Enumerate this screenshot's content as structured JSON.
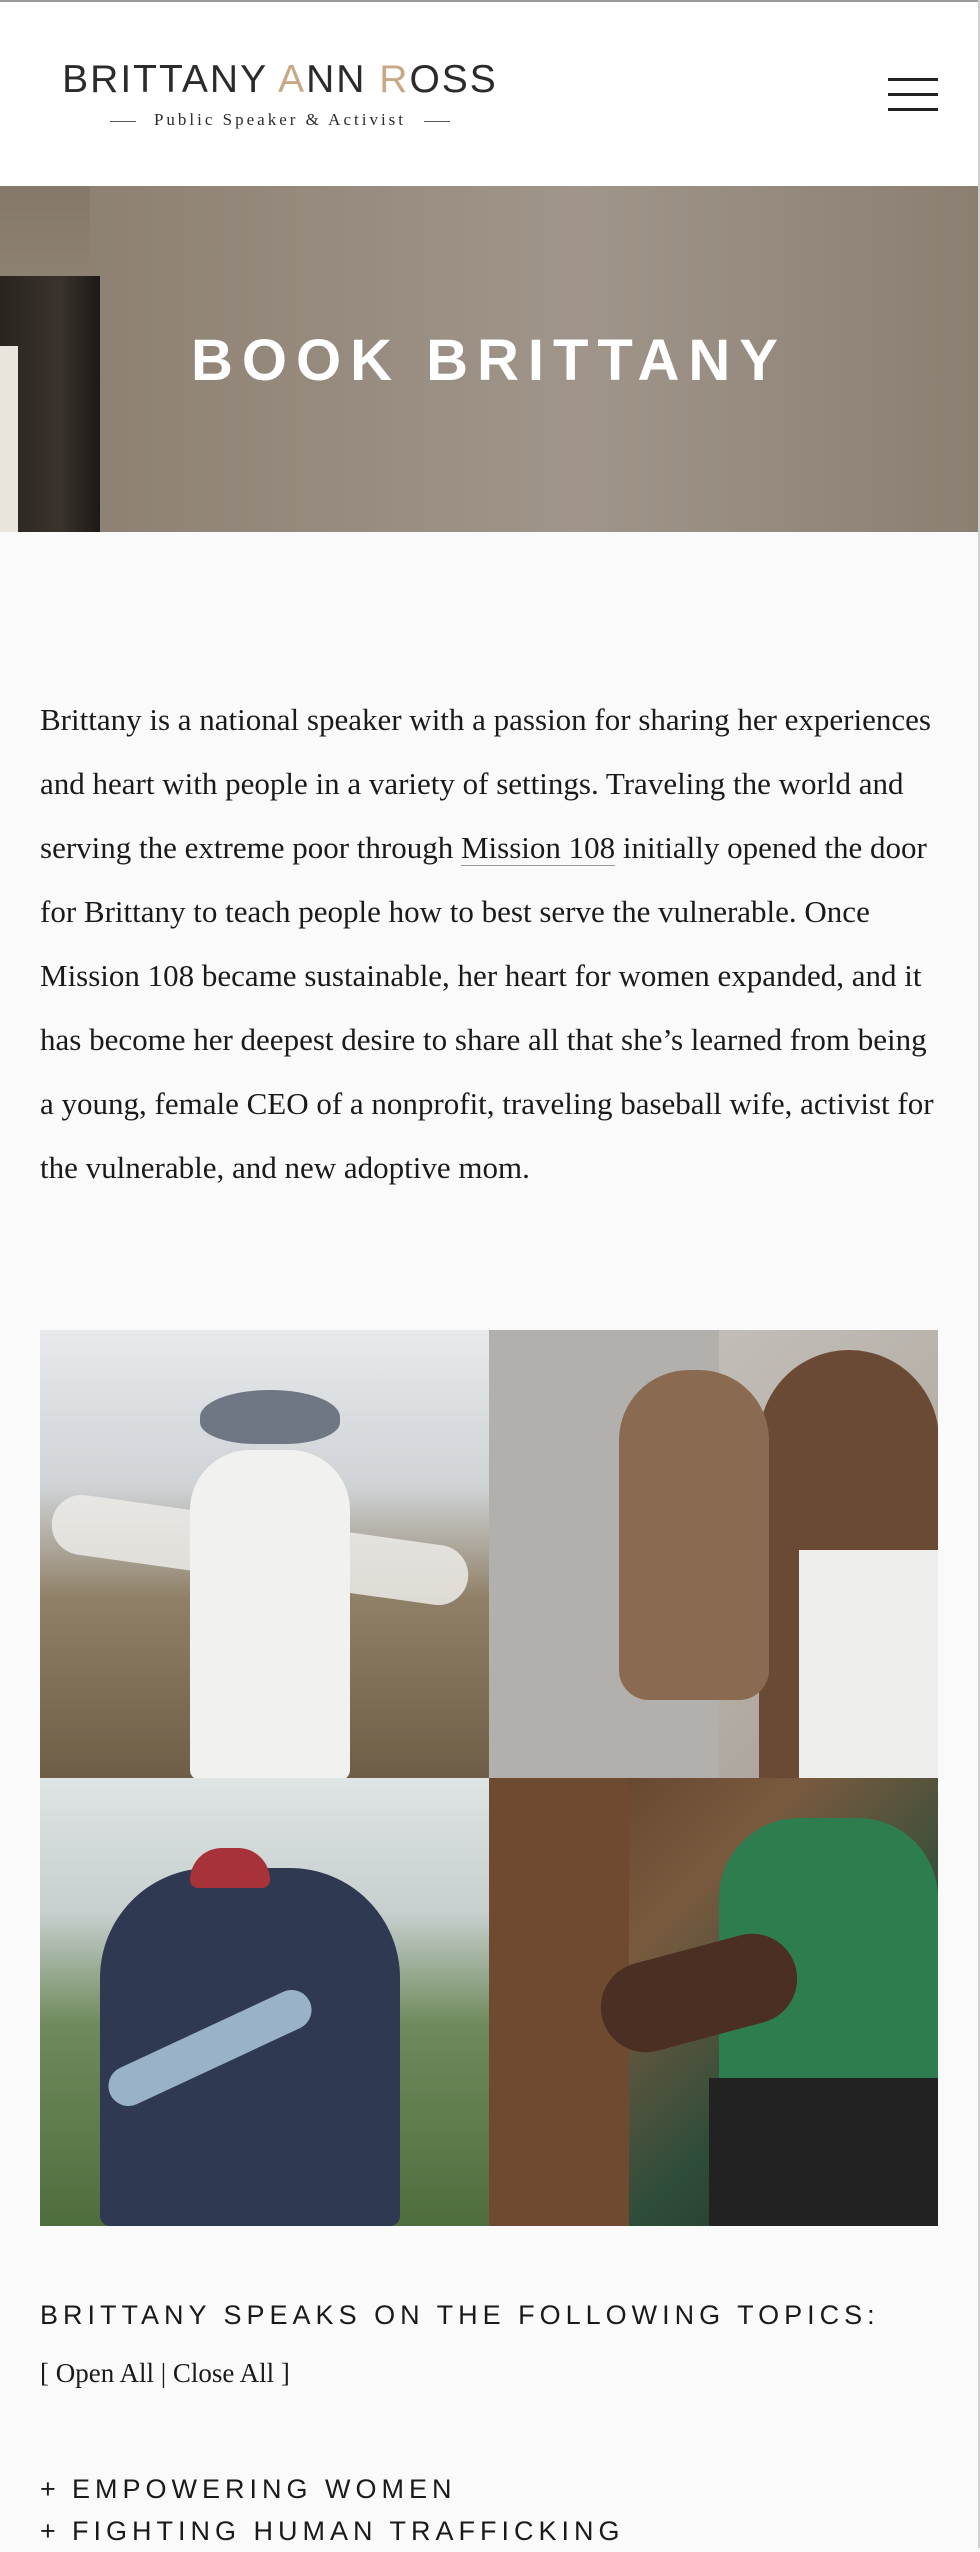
{
  "header": {
    "logo_name_parts": [
      "BRITTANY ",
      "A",
      "NN ",
      "R",
      "OSS"
    ],
    "logo_tagline": "Public Speaker & Activist"
  },
  "hero": {
    "title": "BOOK BRITTANY"
  },
  "intro": {
    "text_before_link": "Brittany is a national speaker with a passion for sharing her experiences and heart with people in a variety of settings. Traveling the world and serving the extreme poor through ",
    "link_text": "Mission 108",
    "text_after_link": " initially opened the door for Brittany to teach people how to best serve the vulnerable. Once Mission 108 became sustainable, her heart for women expanded, and it has become her deepest desire to share all that she’s learned from being a young, female CEO of a nonprofit, traveling baseball wife, activist for the vulnerable, and new adoptive mom."
  },
  "topics": {
    "heading": "BRITTANY SPEAKS ON THE FOLLOWING TOPICS:",
    "open_all": "[ Open All",
    "separator": "|",
    "close_all": "Close All ]",
    "items": [
      {
        "icon": "+",
        "label": "EMPOWERING WOMEN"
      },
      {
        "icon": "+",
        "label": "FIGHTING HUMAN TRAFFICKING"
      }
    ]
  },
  "colors": {
    "accent": "#c9a886",
    "text": "#1a1a1a",
    "background": "#fafafa"
  }
}
